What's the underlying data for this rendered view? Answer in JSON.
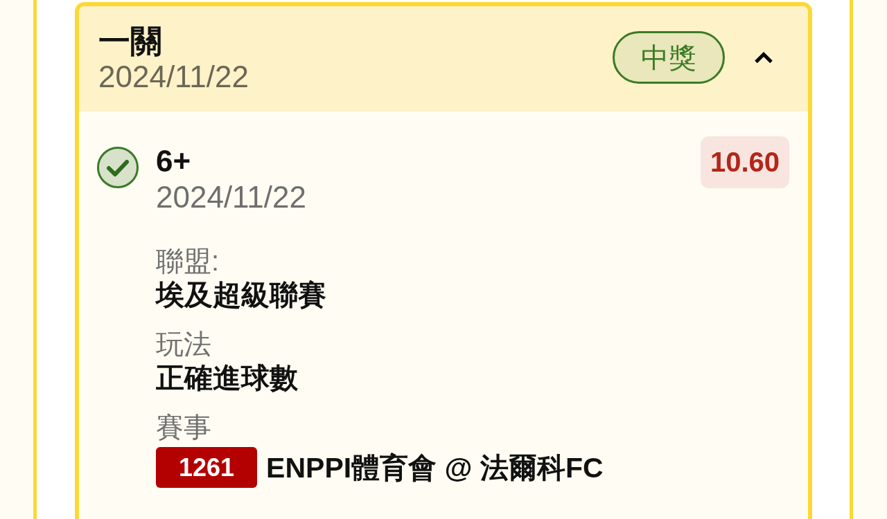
{
  "card": {
    "title": "一關",
    "date": "2024/11/22",
    "status": {
      "label": "中獎",
      "kind": "won"
    },
    "expanded": true
  },
  "selection": {
    "won": true,
    "pick": "6+",
    "date": "2024/11/22",
    "odds": "10.60",
    "details": [
      {
        "kind": "text",
        "label": "聯盟:",
        "value": "埃及超級聯賽"
      },
      {
        "kind": "text",
        "label": "玩法",
        "value": "正確進球數"
      },
      {
        "kind": "match",
        "label": "賽事",
        "number": "1261",
        "value": "ENPPI體育會 @ 法爾科FC"
      }
    ]
  }
}
